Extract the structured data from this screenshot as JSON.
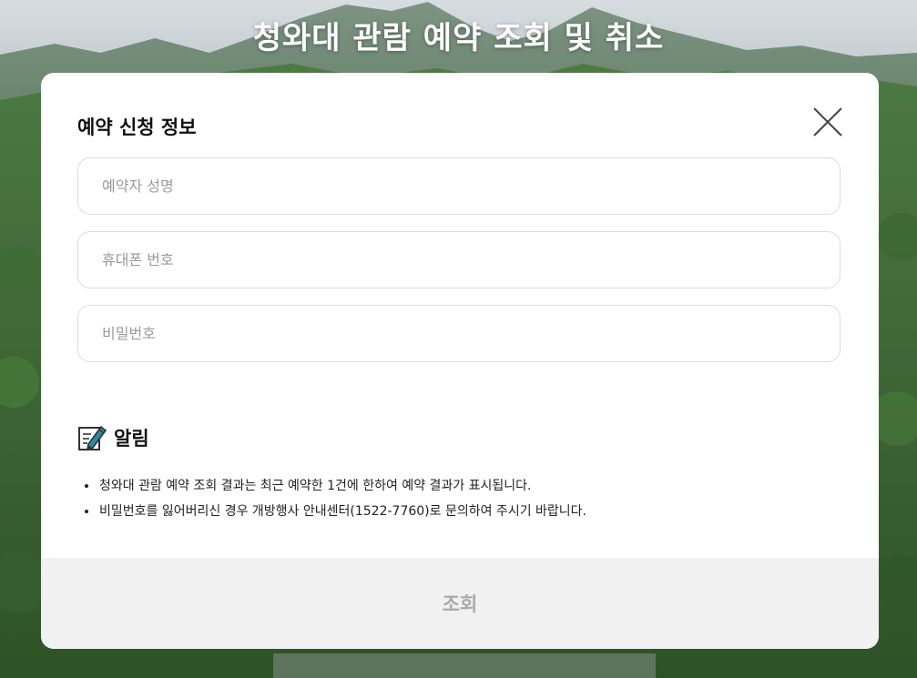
{
  "page": {
    "title": "청와대 관람 예약 조회 및 취소"
  },
  "modal": {
    "section_title": "예약 신청 정보",
    "close_icon": "close-icon",
    "fields": [
      {
        "name": "reserver-name-input",
        "placeholder": "예약자 성명",
        "value": ""
      },
      {
        "name": "phone-number-input",
        "placeholder": "휴대폰 번호",
        "value": ""
      },
      {
        "name": "password-input",
        "placeholder": "비밀번호",
        "value": ""
      }
    ],
    "notice": {
      "icon": "memo-pencil-icon",
      "title": "알림",
      "items": [
        "청와대 관람 예약 조회 결과는 최근 예약한 1건에 한하여 예약 결과가 표시됩니다.",
        "비밀번호를 잃어버리신 경우 개방행사 안내센터(1522-7760)로 문의하여 주시기 바랍니다."
      ]
    },
    "submit_label": "조회"
  },
  "colors": {
    "heading_text": "#ffffff",
    "modal_bg": "#ffffff",
    "submit_bg": "#f1f1f1",
    "submit_text": "#aaaaaa",
    "input_border": "#dcdcdc",
    "placeholder": "#9a9a9a",
    "notice_icon_accent": "#2a8a9e"
  }
}
